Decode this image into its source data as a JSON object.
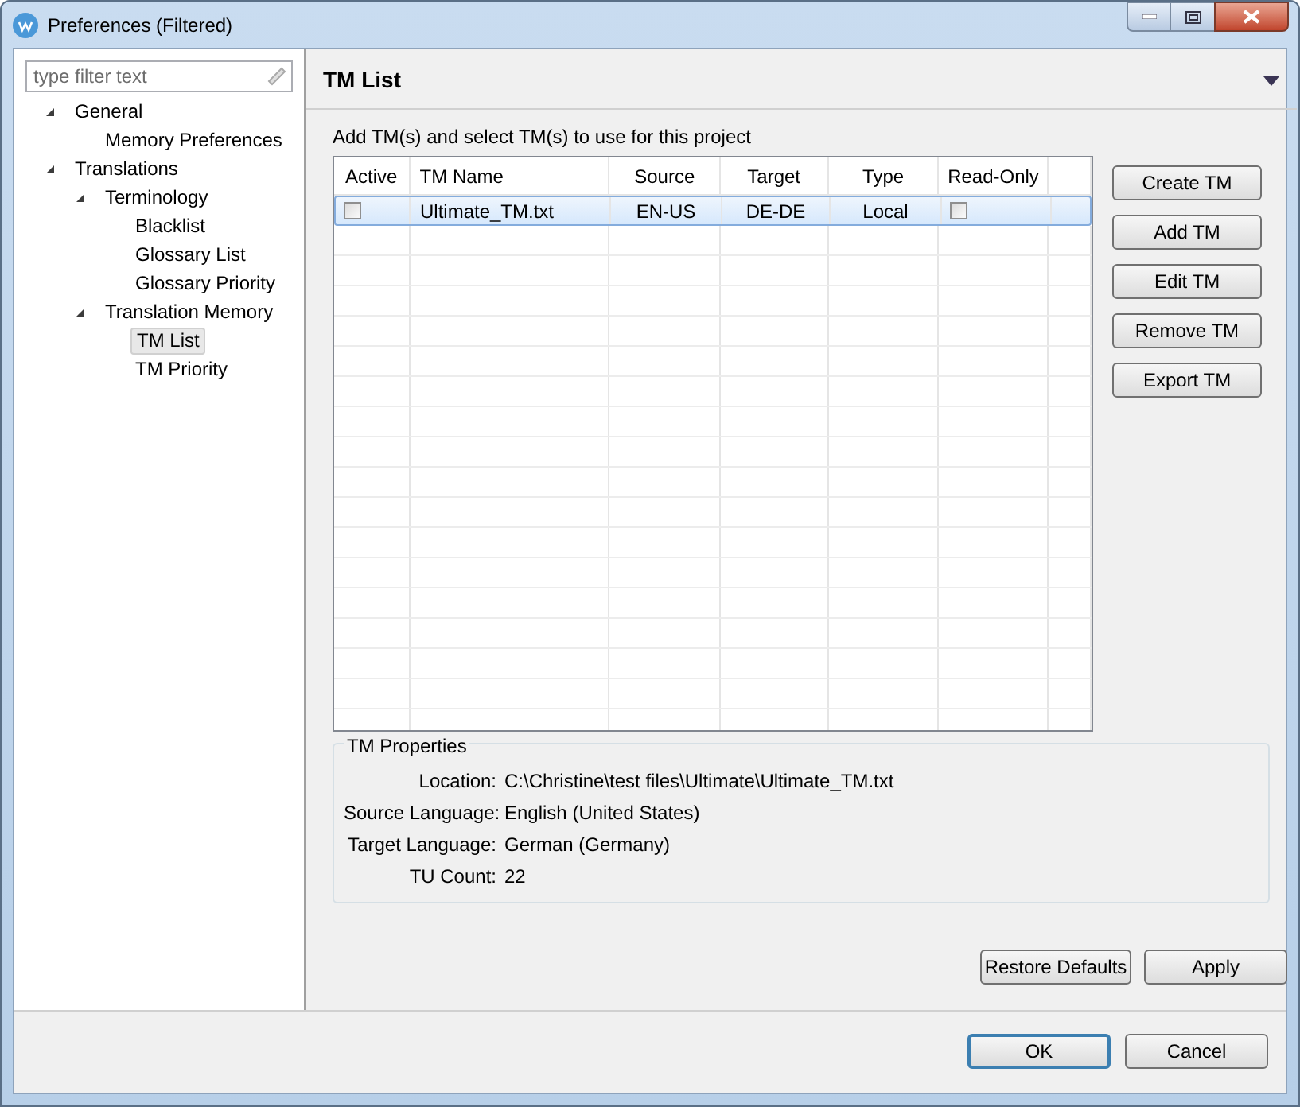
{
  "window": {
    "title": "Preferences (Filtered)"
  },
  "filter": {
    "placeholder": "type filter text"
  },
  "tree": [
    {
      "label": "General",
      "expanded": true,
      "selected": false,
      "children": [
        {
          "label": "Memory Preferences",
          "selected": false
        }
      ]
    },
    {
      "label": "Translations",
      "expanded": true,
      "selected": false,
      "children": [
        {
          "label": "Terminology",
          "expanded": true,
          "selected": false,
          "children": [
            {
              "label": "Blacklist",
              "selected": false
            },
            {
              "label": "Glossary List",
              "selected": false
            },
            {
              "label": "Glossary Priority",
              "selected": false
            }
          ]
        },
        {
          "label": "Translation Memory",
          "expanded": true,
          "selected": false,
          "children": [
            {
              "label": "TM List",
              "selected": true
            },
            {
              "label": "TM Priority",
              "selected": false
            }
          ]
        }
      ]
    }
  ],
  "page": {
    "title": "TM List",
    "instructions": "Add TM(s) and select TM(s) to use for this project"
  },
  "table": {
    "columns": [
      "Active",
      "TM Name",
      "Source",
      "Target",
      "Type",
      "Read-Only"
    ],
    "rows": [
      {
        "active": false,
        "name": "Ultimate_TM.txt",
        "source": "EN-US",
        "target": "DE-DE",
        "type": "Local",
        "read_only": false,
        "selected": true
      }
    ]
  },
  "side_buttons": [
    "Create TM",
    "Add TM",
    "Edit TM",
    "Remove TM",
    "Export TM"
  ],
  "properties": {
    "title": "TM Properties",
    "fields": [
      {
        "label": "Location:",
        "value": "C:\\Christine\\test files\\Ultimate\\Ultimate_TM.txt"
      },
      {
        "label": "Source Language:",
        "value": "English (United States)"
      },
      {
        "label": "Target Language:",
        "value": "German (Germany)"
      },
      {
        "label": "TU Count:",
        "value": "22"
      }
    ]
  },
  "page_buttons": [
    "Restore Defaults",
    "Apply"
  ],
  "dialog_buttons": [
    {
      "label": "OK",
      "default": true
    },
    {
      "label": "Cancel",
      "default": false
    }
  ]
}
